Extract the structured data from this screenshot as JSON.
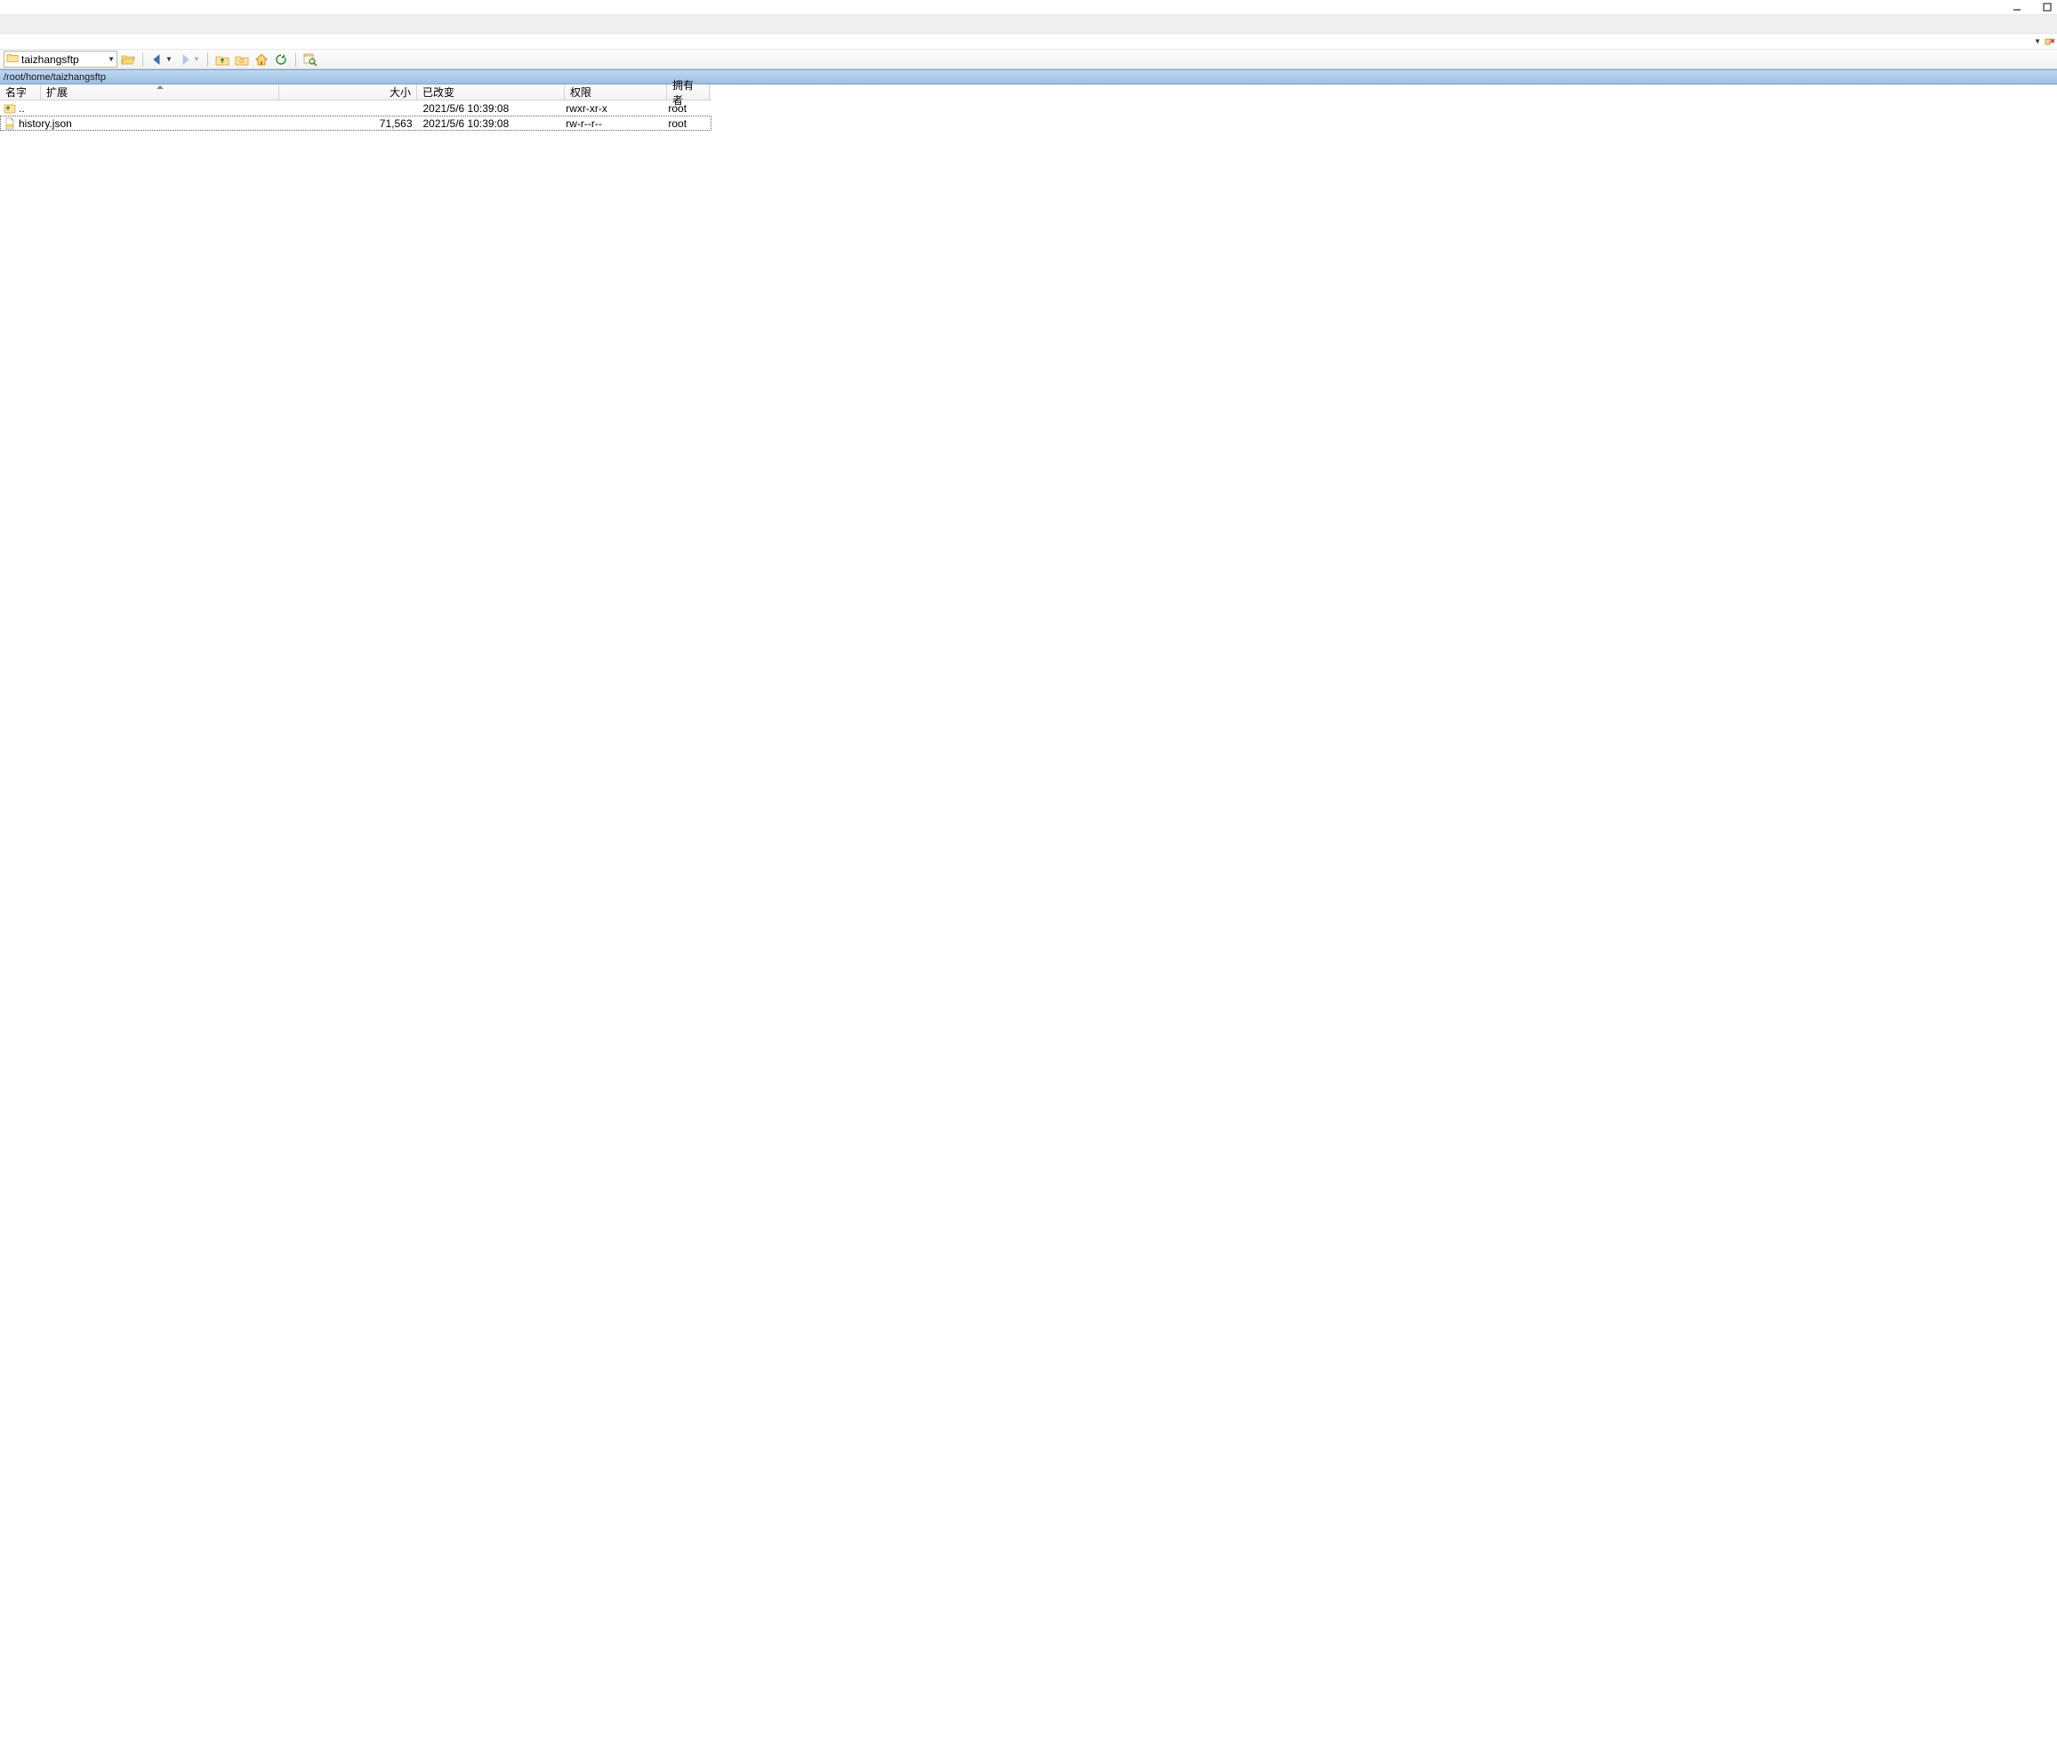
{
  "window": {
    "current_folder": "taizhangsftp",
    "path": "/root/home/taizhangsftp"
  },
  "columns": {
    "name": "名字",
    "ext": "扩展",
    "size": "大小",
    "changed": "已改变",
    "perm": "权限",
    "owner": "拥有者"
  },
  "icons": {
    "minimize": "minimize-icon",
    "maximize": "maximize-icon",
    "folder_open": "folder-open-icon",
    "back": "arrow-left-icon",
    "forward": "arrow-right-icon",
    "parent": "folder-up-icon",
    "refresh": "refresh-icon",
    "home": "home-icon",
    "find": "find-files-icon",
    "tree": "tree-icon",
    "disconnect": "disconnect-icon"
  },
  "rows": [
    {
      "type": "parent",
      "name": "..",
      "size": "",
      "changed": "2021/5/6 10:39:08",
      "perm": "rwxr-xr-x",
      "owner": "root"
    },
    {
      "type": "file",
      "name": "history.json",
      "size": "71,563",
      "changed": "2021/5/6 10:39:08",
      "perm": "rw-r--r--",
      "owner": "root",
      "selected": true
    }
  ]
}
